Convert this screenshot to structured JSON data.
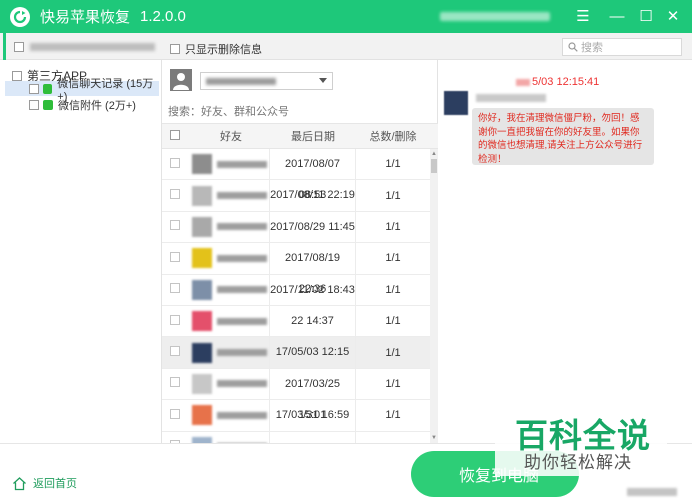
{
  "app": {
    "title": "快易苹果恢复",
    "version": "1.2.0.0"
  },
  "window_controls": {
    "menu": "☰",
    "minimize": "—",
    "maximize": "☐",
    "close": "✕"
  },
  "toolbar": {
    "show_deleted_label": "只显示删除信息",
    "search_placeholder": "搜索"
  },
  "tree": {
    "root": "第三方APP",
    "items": [
      {
        "label": "微信聊天记录 (15万+)",
        "selected": true,
        "icon": "wechat-icon"
      },
      {
        "label": "微信附件 (2万+)",
        "selected": false,
        "icon": "wechat-icon"
      }
    ]
  },
  "contacts": {
    "filter_placeholder": "搜索：好友、群和公众号",
    "columns": {
      "friend": "好友",
      "last_date": "最后日期",
      "total_deleted": "总数/删除"
    },
    "rows": [
      {
        "date": "2017/08/07 08:53",
        "count": "1/1",
        "avatar_color": "#8d8d8d"
      },
      {
        "date": "2017/08/11 22:19",
        "count": "1/1",
        "avatar_color": "#b8b8b8"
      },
      {
        "date": "2017/08/29 11:45",
        "count": "1/1",
        "avatar_color": "#a9a9a9"
      },
      {
        "date": "2017/08/19 22:36",
        "count": "1/1",
        "avatar_color": "#e3c21a"
      },
      {
        "date": "2017/11/02 18:43",
        "count": "1/1",
        "avatar_color": "#7d8fa8"
      },
      {
        "date": "22 14:37",
        "count": "1/1",
        "avatar_color": "#e4506b"
      },
      {
        "date": "17/05/03 12:15",
        "count": "1/1",
        "avatar_color": "#2c3e60",
        "selected": true
      },
      {
        "date": "2017/03/25 15:01",
        "count": "1/1",
        "avatar_color": "#c7c7c7"
      },
      {
        "date": "17/03/31 16:59",
        "count": "1/1",
        "avatar_color": "#e7724a"
      },
      {
        "date": "",
        "count": "",
        "avatar_color": "#9fb4cc"
      }
    ]
  },
  "message": {
    "time": "5/03 12:15:41",
    "text": "你好，我在清理微信僵尸粉，勿回！感谢你一直把我留在你的好友里。如果你的微信也想清理,请关注上方公众号进行检测！"
  },
  "footer": {
    "home_label": "返回首页",
    "recover_label": "恢复到电脑"
  },
  "watermark": {
    "main": "百科全说",
    "sub": "助你轻松解决"
  },
  "colors": {
    "brand_green": "#1ec87a",
    "message_red": "#e0291f",
    "selection_blue": "#dbe8f8"
  }
}
